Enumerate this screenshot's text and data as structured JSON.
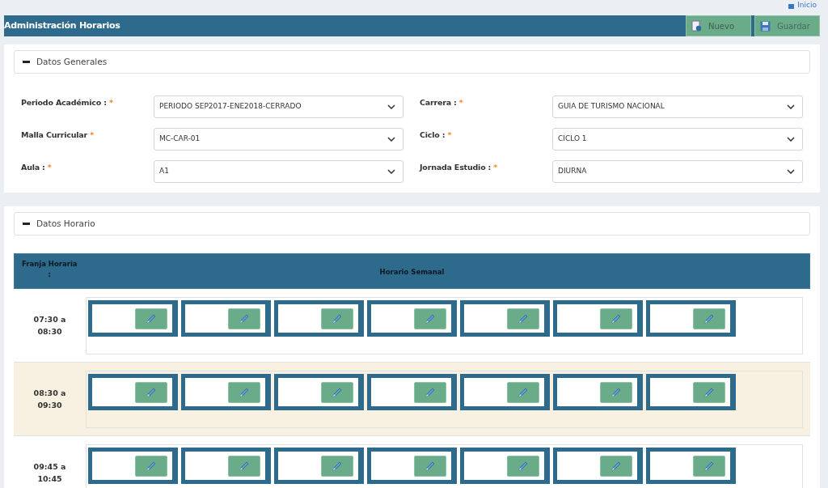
{
  "top_link": {
    "label": "Inicio"
  },
  "header": {
    "title": "Administración Horarios",
    "buttons": [
      {
        "label": "Nuevo",
        "kind": "new"
      },
      {
        "label": "Guardar",
        "kind": "save"
      }
    ]
  },
  "general_section": {
    "title": "Datos Generales",
    "expanded": true,
    "fields": [
      {
        "label": "Periodo Académico :",
        "required_mark": "*",
        "value": "PERIODO SEP2017-ENE2018-CERRADO"
      },
      {
        "label": "Carrera :",
        "required_mark": "*",
        "value": "GUIA DE TURISMO NACIONAL"
      },
      {
        "label": "Malla Curricular",
        "required_mark": "*",
        "value": "MC-CAR-01"
      },
      {
        "label": "Ciclo :",
        "required_mark": "*",
        "value": "CICLO 1"
      },
      {
        "label": "Aula :",
        "required_mark": "*",
        "value": "A1"
      },
      {
        "label": "Jornada Estudio :",
        "required_mark": "*",
        "value": "DIURNA"
      }
    ]
  },
  "schedule_section": {
    "title": "Datos Horario",
    "expanded": true,
    "columns": [
      {
        "label": "Franja Horaria",
        "sub": ":"
      },
      {
        "label": "Horario Semanal"
      }
    ],
    "rows": [
      {
        "time": [
          "07:30 a",
          "08:30"
        ],
        "highlighted": false,
        "slots": [
          {
            "kind": "empty"
          },
          {
            "kind": "empty"
          },
          {
            "kind": "empty"
          },
          {
            "kind": "empty"
          },
          {
            "kind": "empty"
          },
          {
            "kind": "empty"
          },
          {
            "kind": "empty"
          }
        ]
      },
      {
        "time": [
          "08:30 a",
          "09:30"
        ],
        "highlighted": true,
        "slots": [
          {
            "kind": "empty"
          },
          {
            "kind": "empty"
          },
          {
            "kind": "empty"
          },
          {
            "kind": "empty"
          },
          {
            "kind": "empty"
          },
          {
            "kind": "empty"
          },
          {
            "kind": "empty"
          }
        ]
      },
      {
        "time": [
          "09:45 a",
          "10:45"
        ],
        "highlighted": false,
        "slots": [
          {
            "kind": "empty"
          },
          {
            "kind": "empty"
          },
          {
            "kind": "empty"
          },
          {
            "kind": "empty"
          },
          {
            "kind": "empty"
          },
          {
            "kind": "empty"
          },
          {
            "kind": "empty"
          }
        ]
      }
    ]
  }
}
